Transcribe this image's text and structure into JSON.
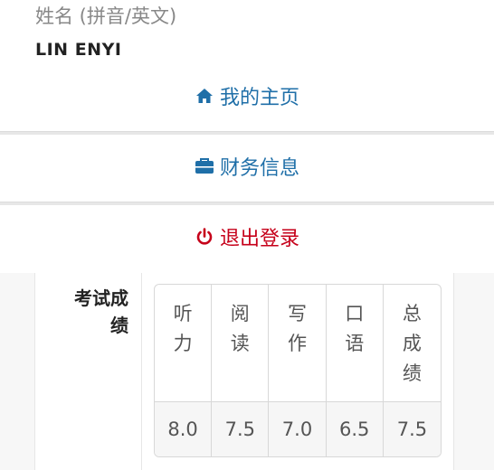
{
  "profile": {
    "name_label": "姓名 (拼音/英文)",
    "name_value": "LIN  ENYI"
  },
  "menu": {
    "home_label": "我的主页",
    "finance_label": "财务信息",
    "logout_label": "退出登录"
  },
  "colors": {
    "link": "#1f6fa8",
    "logout": "#c6001a"
  },
  "scores": {
    "label": "考试成绩",
    "headers": [
      "听力",
      "阅读",
      "写作",
      "口语",
      "总成绩"
    ],
    "values": [
      "8.0",
      "7.5",
      "7.0",
      "6.5",
      "7.5"
    ]
  }
}
